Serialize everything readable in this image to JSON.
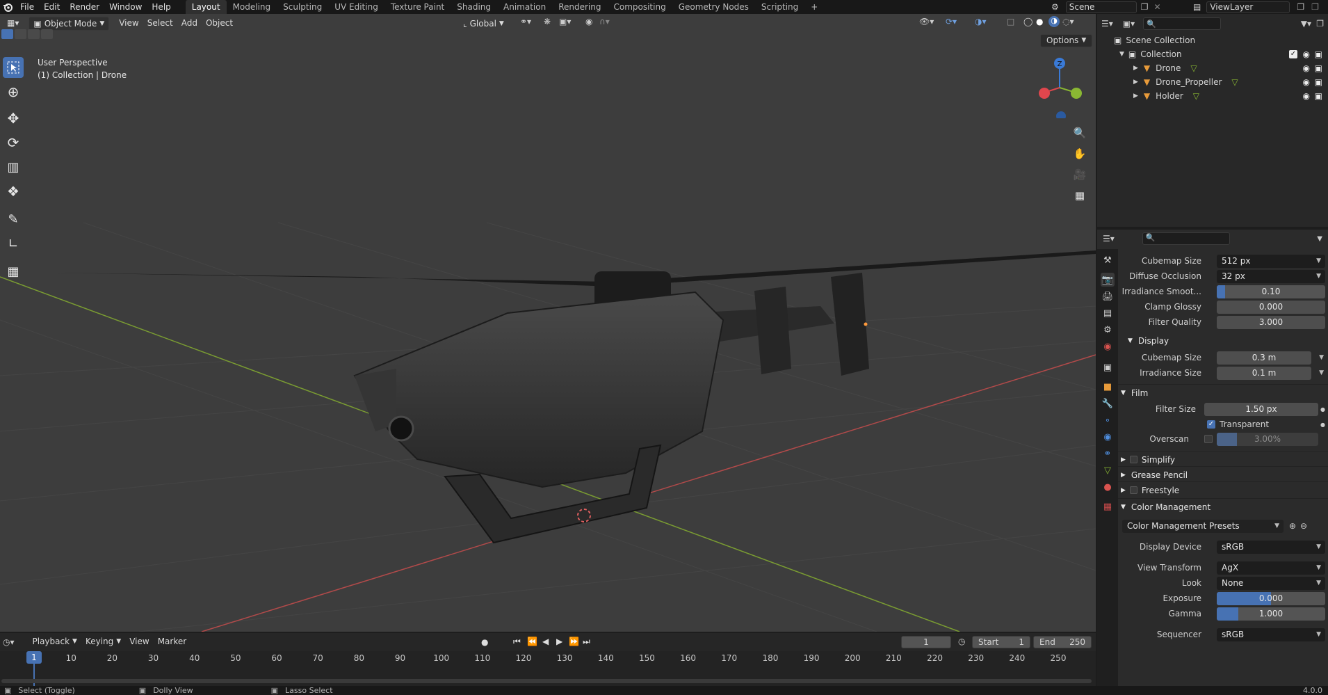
{
  "topbar": {
    "menus": [
      "File",
      "Edit",
      "Render",
      "Window",
      "Help"
    ],
    "workspaces": [
      "Layout",
      "Modeling",
      "Sculpting",
      "UV Editing",
      "Texture Paint",
      "Shading",
      "Animation",
      "Rendering",
      "Compositing",
      "Geometry Nodes",
      "Scripting"
    ],
    "active_workspace": "Layout",
    "add_tab": "+",
    "scene_label": "Scene",
    "viewlayer_label": "ViewLayer"
  },
  "viewport": {
    "mode": "Object Mode",
    "menus": [
      "View",
      "Select",
      "Add",
      "Object"
    ],
    "transform_orientation": "Global",
    "options_label": "Options",
    "info_line1": "User Perspective",
    "info_line2": "(1) Collection | Drone",
    "gizmo_axes": {
      "z": "Z",
      "x": "X",
      "y": "Y"
    }
  },
  "outliner": {
    "search_placeholder": "",
    "items": [
      {
        "label": "Scene Collection",
        "level": 0
      },
      {
        "label": "Collection",
        "level": 1
      },
      {
        "label": "Drone",
        "level": 2
      },
      {
        "label": "Drone_Propeller",
        "level": 2
      },
      {
        "label": "Holder",
        "level": 2
      }
    ]
  },
  "properties": {
    "rows": [
      {
        "label": "Cubemap Size",
        "value": "512 px",
        "kind": "dropdown"
      },
      {
        "label": "Diffuse Occlusion",
        "value": "32 px",
        "kind": "dropdown"
      },
      {
        "label": "Irradiance Smoot...",
        "value": "0.10",
        "kind": "slider",
        "fill": 0.08
      },
      {
        "label": "Clamp Glossy",
        "value": "0.000",
        "kind": "field"
      },
      {
        "label": "Filter Quality",
        "value": "3.000",
        "kind": "field"
      }
    ],
    "display_section": "Display",
    "display_rows": [
      {
        "label": "Cubemap Size",
        "value": "0.3 m"
      },
      {
        "label": "Irradiance Size",
        "value": "0.1 m"
      }
    ],
    "film_section": "Film",
    "film_rows": {
      "filter_size_label": "Filter Size",
      "filter_size_value": "1.50 px",
      "transparent_label": "Transparent",
      "overscan_label": "Overscan",
      "overscan_value": "3.00%"
    },
    "collapsed_sections": [
      "Simplify",
      "Grease Pencil",
      "Freestyle"
    ],
    "color_mgmt_section": "Color Management",
    "color_mgmt_presets": "Color Management Presets",
    "color_mgmt_rows": [
      {
        "label": "Display Device",
        "value": "sRGB",
        "kind": "dropdown"
      },
      {
        "label": "View Transform",
        "value": "AgX",
        "kind": "dropdown"
      },
      {
        "label": "Look",
        "value": "None",
        "kind": "dropdown"
      },
      {
        "label": "Exposure",
        "value": "0.000",
        "kind": "slider",
        "fill": 0.5
      },
      {
        "label": "Gamma",
        "value": "1.000",
        "kind": "slider",
        "fill": 0.2
      },
      {
        "label": "Sequencer",
        "value": "sRGB",
        "kind": "dropdown"
      }
    ]
  },
  "timeline": {
    "menus": [
      "Playback",
      "Keying",
      "View",
      "Marker"
    ],
    "current_frame": "1",
    "start_label": "Start",
    "start_value": "1",
    "end_label": "End",
    "end_value": "250",
    "ticks": [
      "1",
      "10",
      "20",
      "30",
      "40",
      "50",
      "60",
      "70",
      "80",
      "90",
      "100",
      "110",
      "120",
      "130",
      "140",
      "150",
      "160",
      "170",
      "180",
      "190",
      "200",
      "210",
      "220",
      "230",
      "240",
      "250"
    ]
  },
  "statusbar": {
    "items": [
      "Select (Toggle)",
      "Dolly View",
      "Lasso Select"
    ],
    "version": "4.0.0"
  },
  "colors": {
    "accent": "#4772b3",
    "axis_x": "#e0464d",
    "axis_y": "#8ab833",
    "axis_z": "#3a7ad6",
    "viewport_bg": "#3d3d3d"
  }
}
